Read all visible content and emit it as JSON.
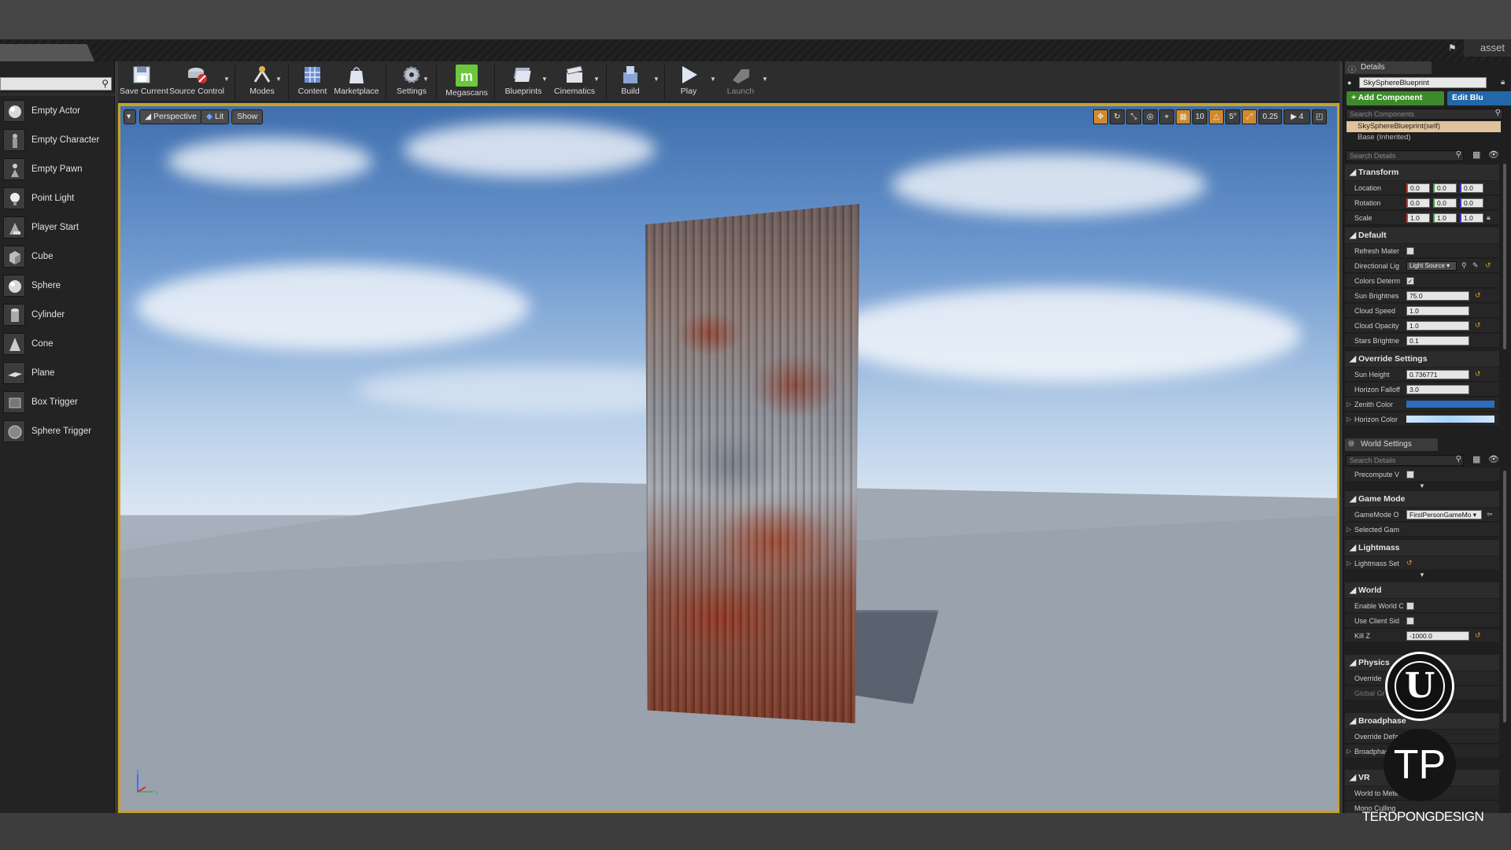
{
  "window": {
    "left_tab": "",
    "right_tab": "asset"
  },
  "place_items": [
    {
      "label": "Empty Actor",
      "icon": "sphere-icon"
    },
    {
      "label": "Empty Character",
      "icon": "character-icon"
    },
    {
      "label": "Empty Pawn",
      "icon": "pawn-icon"
    },
    {
      "label": "Point Light",
      "icon": "bulb-icon"
    },
    {
      "label": "Player Start",
      "icon": "player-start-icon"
    },
    {
      "label": "Cube",
      "icon": "cube-icon"
    },
    {
      "label": "Sphere",
      "icon": "sphere-icon"
    },
    {
      "label": "Cylinder",
      "icon": "cylinder-icon"
    },
    {
      "label": "Cone",
      "icon": "cone-icon"
    },
    {
      "label": "Plane",
      "icon": "plane-icon"
    },
    {
      "label": "Box Trigger",
      "icon": "box-trigger-icon"
    },
    {
      "label": "Sphere Trigger",
      "icon": "sphere-trigger-icon"
    }
  ],
  "toolbar": {
    "save_current": "Save Current",
    "source_control": "Source Control",
    "modes": "Modes",
    "content": "Content",
    "marketplace": "Marketplace",
    "settings": "Settings",
    "megascans": "Megascans",
    "blueprints": "Blueprints",
    "cinematics": "Cinematics",
    "build": "Build",
    "play": "Play",
    "launch": "Launch"
  },
  "viewport": {
    "perspective": "Perspective",
    "lit": "Lit",
    "show": "Show",
    "grid_snap": "10",
    "rotation_snap": "5°",
    "scale_snap": "0.25",
    "camera_speed": "4"
  },
  "details": {
    "tab": "Details",
    "actor_name": "SkySphereBlueprint",
    "add_component": "+ Add Component",
    "edit_blueprint": "Edit Blu",
    "search_components": "Search Components",
    "component_self": "SkySphereBlueprint(self)",
    "component_base": "Base (Inherited)",
    "search_details": "Search Details",
    "transform": {
      "title": "Transform",
      "location_label": "Location",
      "rotation_label": "Rotation",
      "scale_label": "Scale",
      "location": [
        "0.0",
        "0.0",
        "0.0"
      ],
      "rotation": [
        "0.0",
        "0.0",
        "0.0"
      ],
      "scale": [
        "1.0",
        "1.0",
        "1.0"
      ]
    },
    "default": {
      "title": "Default",
      "refresh_material": "Refresh Mater",
      "directional_light": "Directional Lig",
      "directional_light_value": "Light Source",
      "colors_determined": "Colors Determ",
      "sun_brightness": "Sun Brightnes",
      "sun_brightness_value": "75.0",
      "cloud_speed": "Cloud Speed",
      "cloud_speed_value": "1.0",
      "cloud_opacity": "Cloud Opacity",
      "cloud_opacity_value": "1.0",
      "stars_brightness": "Stars Brightne",
      "stars_brightness_value": "0.1"
    },
    "override": {
      "title": "Override Settings",
      "sun_height": "Sun Height",
      "sun_height_value": "0.736771",
      "horizon_falloff": "Horizon Falloff",
      "horizon_falloff_value": "3.0",
      "zenith_color": "Zenith Color",
      "horizon_color": "Horizon Color",
      "zenith_hex": "#2f6bbf",
      "horizon_hex": "#cfe6fb"
    }
  },
  "world_settings": {
    "tab": "World Settings",
    "search_details": "Search Details",
    "precompute": "Precompute V",
    "game_mode_title": "Game Mode",
    "gamemode_override": "GameMode O",
    "gamemode_value": "FirstPersonGameMo",
    "selected_game": "Selected Gam",
    "lightmass_title": "Lightmass",
    "lightmass_settings": "Lightmass Set",
    "world_title": "World",
    "enable_world": "Enable World C",
    "use_client_side": "Use Client Sid",
    "kill_z": "Kill Z",
    "kill_z_value": "-1000.0",
    "physics_title": "Physics",
    "override": "Override",
    "global_gravity": "Global Gr",
    "broadphase_title": "Broadphase",
    "override_defaults": "Override Defa",
    "broadphase_settings": "Broadphas",
    "vr_title": "VR",
    "world_to_meters": "World to Mete",
    "mono_culling": "Mono Culling"
  },
  "watermark": {
    "ue_letter": "U",
    "tp_letters": "TP",
    "brand": "TERDPONGDESIGN"
  },
  "colors": {
    "accent_gold": "#c9a326",
    "green": "#3d8a2c",
    "blue": "#2367a8"
  }
}
